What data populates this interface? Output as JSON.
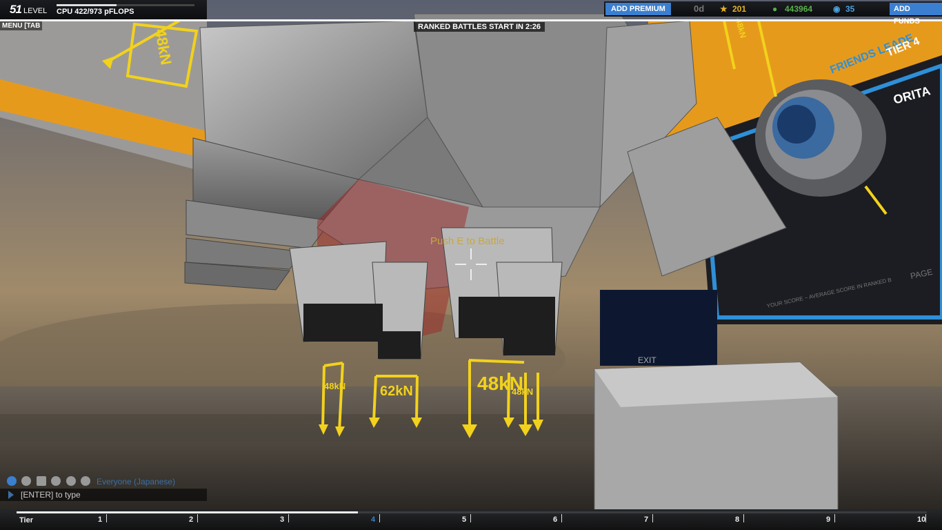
{
  "hud": {
    "level_number": "51",
    "level_word": "LEVEL",
    "cpu_text": "CPU 422/973 pFLOPS",
    "cpu_fraction": 0.434,
    "menu_tab": "MENU [TAB",
    "ranked_timer": "RANKED BATTLES START IN 2:26",
    "add_premium": "ADD PREMIUM",
    "premium_days": "0d",
    "stars": "201",
    "robit_points": "443964",
    "cosmetic_credits": "35",
    "add_funds": "ADD FUNDS",
    "prompt": "Push E to Battle"
  },
  "force_labels": [
    "48kN",
    "48kN",
    "62kN",
    "48kN",
    "48kN",
    "48kN"
  ],
  "sign_text": {
    "leaderboard": "FRIENDS LEADE",
    "tier": "TIER 4",
    "favorite": "ORITA",
    "score": "YOUR SCORE ~ AVERAGE SCORE IN RANKED B",
    "page": "PAGE",
    "exit": "EXIT"
  },
  "chat": {
    "channel": "Everyone (Japanese)",
    "input_hint": "[ENTER] to type",
    "icons": [
      "globe-icon",
      "person-icon",
      "p-icon",
      "party1-icon",
      "party2-icon",
      "party3-icon"
    ]
  },
  "tiers": {
    "label": "Tier",
    "marks": [
      "1",
      "2",
      "3",
      "4",
      "5",
      "6",
      "7",
      "8",
      "9",
      "10"
    ],
    "progress_fraction": 0.375
  },
  "colors": {
    "accent_blue": "#3a7fd0",
    "force_yellow": "#f2d21c",
    "star_gold": "#e6b422",
    "rp_green": "#5ab04a",
    "cc_blue": "#4aa0e0"
  }
}
